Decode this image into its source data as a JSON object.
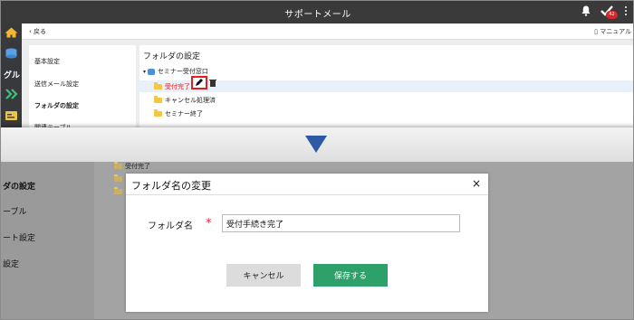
{
  "app": {
    "title": "サポートメール",
    "badge_count": "42"
  },
  "subbar": {
    "back": "戻る",
    "manual": "マニュアル"
  },
  "leftnav": {
    "label": "グル"
  },
  "settings_menu": [
    "基本設定",
    "送信メール設定",
    "フォルダの設定",
    "関連テーブル"
  ],
  "panel": {
    "title": "フォルダの設定",
    "root": "セミナー受付窓口",
    "folders": [
      "受付完了",
      "キャンセル処理済",
      "セミナー終了"
    ]
  },
  "background": {
    "folder": "受付完了",
    "menu": [
      "ダの設定",
      "ーブル",
      "ート設定",
      "設定"
    ]
  },
  "dialog": {
    "title": "フォルダ名の変更",
    "close": "×",
    "field_label": "フォルダ名",
    "required_mark": "*",
    "field_value": "受付手続き完了",
    "cancel": "キャンセル",
    "save": "保存する"
  },
  "colors": {
    "accent": "#2ea06a",
    "arrow": "#2d5aa6",
    "required": "#d9262c",
    "topbar": "#3a3a3a"
  }
}
